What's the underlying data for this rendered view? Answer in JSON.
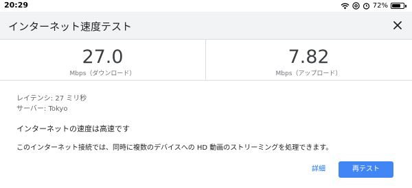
{
  "status_bar": {
    "time": "20:29",
    "battery": "72%",
    "battery_level": 0.72,
    "icons": [
      "wifi-icon",
      "at-sign-icon",
      "alarm-icon"
    ]
  },
  "header": {
    "title": "インターネット速度テスト",
    "close_icon": "close-icon"
  },
  "download": {
    "value": "27.0",
    "unit": "Mbps（ダウンロード）"
  },
  "upload": {
    "value": "7.82",
    "unit": "Mbps（アップロード）"
  },
  "details": {
    "latency_label": "レイテンシ: ",
    "latency_value": "27 ミリ秒",
    "server_label": "サーバー: ",
    "server_value": "Tokyo"
  },
  "summary": "インターネットの速度は高速です",
  "description": "このインターネット接続では、同時に複数のデバイスへの HD 動画のストリーミングを処理できます。",
  "actions": {
    "details_label": "詳細",
    "retest_label": "再テスト"
  },
  "colors": {
    "accent": "#4285f4",
    "link": "#1a73e8",
    "header_bg": "#f1f3f4"
  }
}
